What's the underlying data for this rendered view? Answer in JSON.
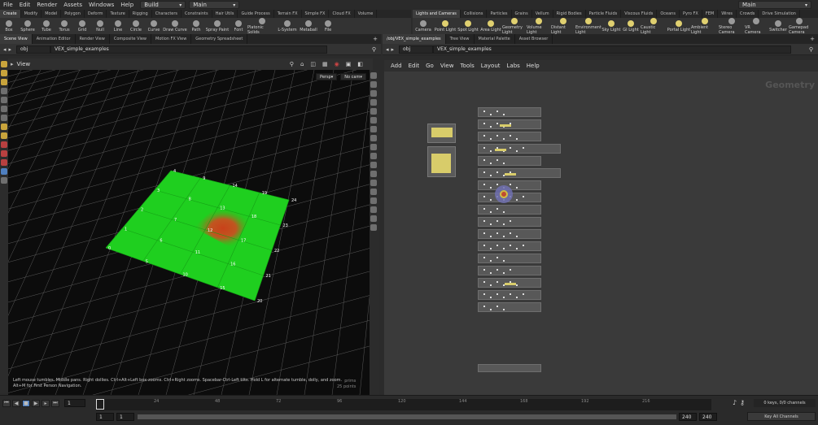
{
  "menubar": {
    "items": [
      "File",
      "Edit",
      "Render",
      "Assets",
      "Windows",
      "Help"
    ],
    "desktop": "Build",
    "context": "Main",
    "right_context": "Main"
  },
  "shelf_left_tabs": [
    "Create",
    "Modify",
    "Model",
    "Polygon",
    "Deform",
    "Texture",
    "Rigging",
    "Characters",
    "Constraints",
    "Hair Utils",
    "Guide Process",
    "Terrain FX",
    "Simple FX",
    "Cloud FX",
    "Volume"
  ],
  "shelf_right_tabs": [
    "Lights and Cameras",
    "Collisions",
    "Particles",
    "Grains",
    "Vellum",
    "Rigid Bodies",
    "Particle Fluids",
    "Viscous Fluids",
    "Oceans",
    "Pyro FX",
    "FEM",
    "Wires",
    "Crowds",
    "Drive Simulation"
  ],
  "tools_left": [
    "Box",
    "Sphere",
    "Tube",
    "Torus",
    "Grid",
    "Null",
    "Line",
    "Circle",
    "Curve",
    "Draw Curve",
    "Path",
    "Spray Paint",
    "Font",
    "Platonic Solids",
    "L-System",
    "Metaball",
    "File"
  ],
  "tools_right": [
    "Camera",
    "Point Light",
    "Spot Light",
    "Area Light",
    "Geometry Light",
    "Volume Light",
    "Distant Light",
    "Environment Light",
    "Sky Light",
    "GI Light",
    "Caustic Light",
    "Portal Light",
    "Ambient Light",
    "Stereo Camera",
    "VR Camera",
    "Switcher",
    "Gamepad Camera"
  ],
  "pane_tabs_left": [
    "Scene View",
    "Animation Editor",
    "Render View",
    "Composite View",
    "Motion FX View",
    "Geometry Spreadsheet"
  ],
  "pane_tabs_right": [
    "/obj/VEX_simple_examples",
    "Tree View",
    "Material Palette",
    "Asset Browser"
  ],
  "path_left": {
    "root": "obj",
    "node": "VEX_simple_examples"
  },
  "path_right": {
    "root": "obj",
    "node": "VEX_simple_examples"
  },
  "viewport": {
    "title": "View",
    "persp": "Persp",
    "cam": "No cam",
    "hint1": "Left mouse tumbles. Middle pans. Right dollies. Ctrl+Alt+Left box-zooms. Ctrl+Right zooms. Spacebar-Ctrl-Left tilts. Hold L for alternate tumble, dolly, and zoom.",
    "hint2": "Alt+M for First Person Navigation.",
    "prims": "prims",
    "points": "25 points"
  },
  "point_numbers": [
    "0",
    "1",
    "2",
    "3",
    "4",
    "5",
    "6",
    "7",
    "8",
    "9",
    "10",
    "11",
    "12",
    "13",
    "14",
    "15",
    "16",
    "17",
    "18",
    "19",
    "20",
    "21",
    "22",
    "23",
    "24"
  ],
  "network": {
    "menu": [
      "Add",
      "Edit",
      "Go",
      "View",
      "Tools",
      "Layout",
      "Labs",
      "Help"
    ],
    "watermark": "Geometry"
  },
  "timeline": {
    "current_frame": "1",
    "ticks": [
      "24",
      "48",
      "72",
      "96",
      "120",
      "144",
      "168",
      "192",
      "216"
    ],
    "start": "1",
    "start2": "1",
    "end": "240",
    "end2": "240",
    "keys": "0 keys, 0/0 channels",
    "key_all": "Key All Channels"
  },
  "colors": {
    "grid_green": "#1fcf1f",
    "hot_red": "#d23a1a",
    "node_yellow": "#d8cc6a",
    "highlight_blue": "#6a6ad0"
  }
}
